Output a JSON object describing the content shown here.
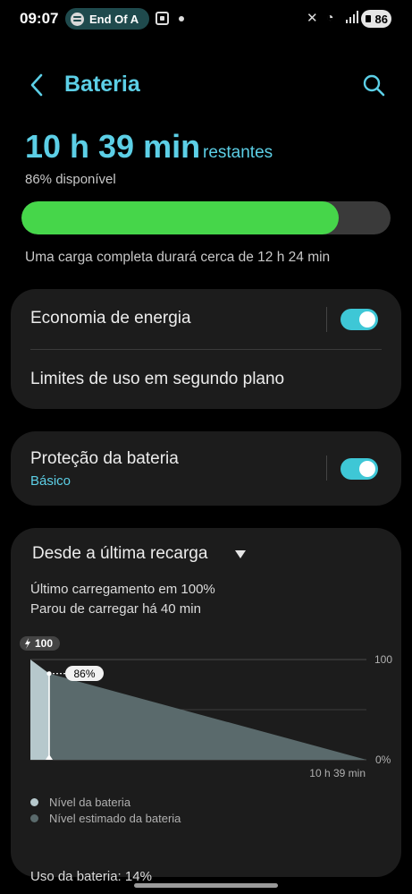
{
  "status_bar": {
    "time": "09:07",
    "media_text": "End Of A",
    "battery_level": "86",
    "icons": [
      "spotify-icon",
      "screenshot-icon",
      "notification-dot-icon",
      "mute-icon",
      "wifi-icon",
      "signal-icon",
      "battery-icon"
    ]
  },
  "header": {
    "title": "Bateria",
    "back_icon": "chevron-left-icon",
    "search_icon": "search-icon"
  },
  "summary": {
    "time_left": "10 h 39 min",
    "remaining_label": "restantes",
    "available": "86% disponível",
    "level_fraction": 0.86,
    "full_charge_text": "Uma carga completa durará cerca de 12 h 24 min"
  },
  "card1": {
    "power_saving_label": "Economia de energia",
    "power_saving_on": true,
    "background_limits_label": "Limites de uso em segundo plano"
  },
  "card2": {
    "protection_label": "Proteção da bateria",
    "protection_sub": "Básico",
    "protection_on": true
  },
  "usage_card": {
    "dropdown_label": "Desde a última recarga",
    "last_charge": "Último carregamento em 100%",
    "stopped": "Parou de carregar há 40 min",
    "usage_text": "Uso da bateria: 14%"
  },
  "chart_data": {
    "type": "area",
    "y_ticks": [
      "100",
      "0%"
    ],
    "x_tick_end": "10 h 39 min",
    "start_badge": "100",
    "current_badge": "86%",
    "series": [
      {
        "name": "Nível da bateria",
        "values": [
          100,
          86
        ]
      },
      {
        "name": "Nível estimado da bateria",
        "values": [
          86,
          0
        ]
      }
    ],
    "ylim": [
      0,
      100
    ],
    "grid": true,
    "legend_position": "bottom"
  },
  "colors": {
    "accent": "#5ccfe6",
    "bar_fill": "#46d64a",
    "toggle": "#3ec7d6",
    "actual_level": "#b6c8cc",
    "estimated_level": "#5a6a6c"
  }
}
